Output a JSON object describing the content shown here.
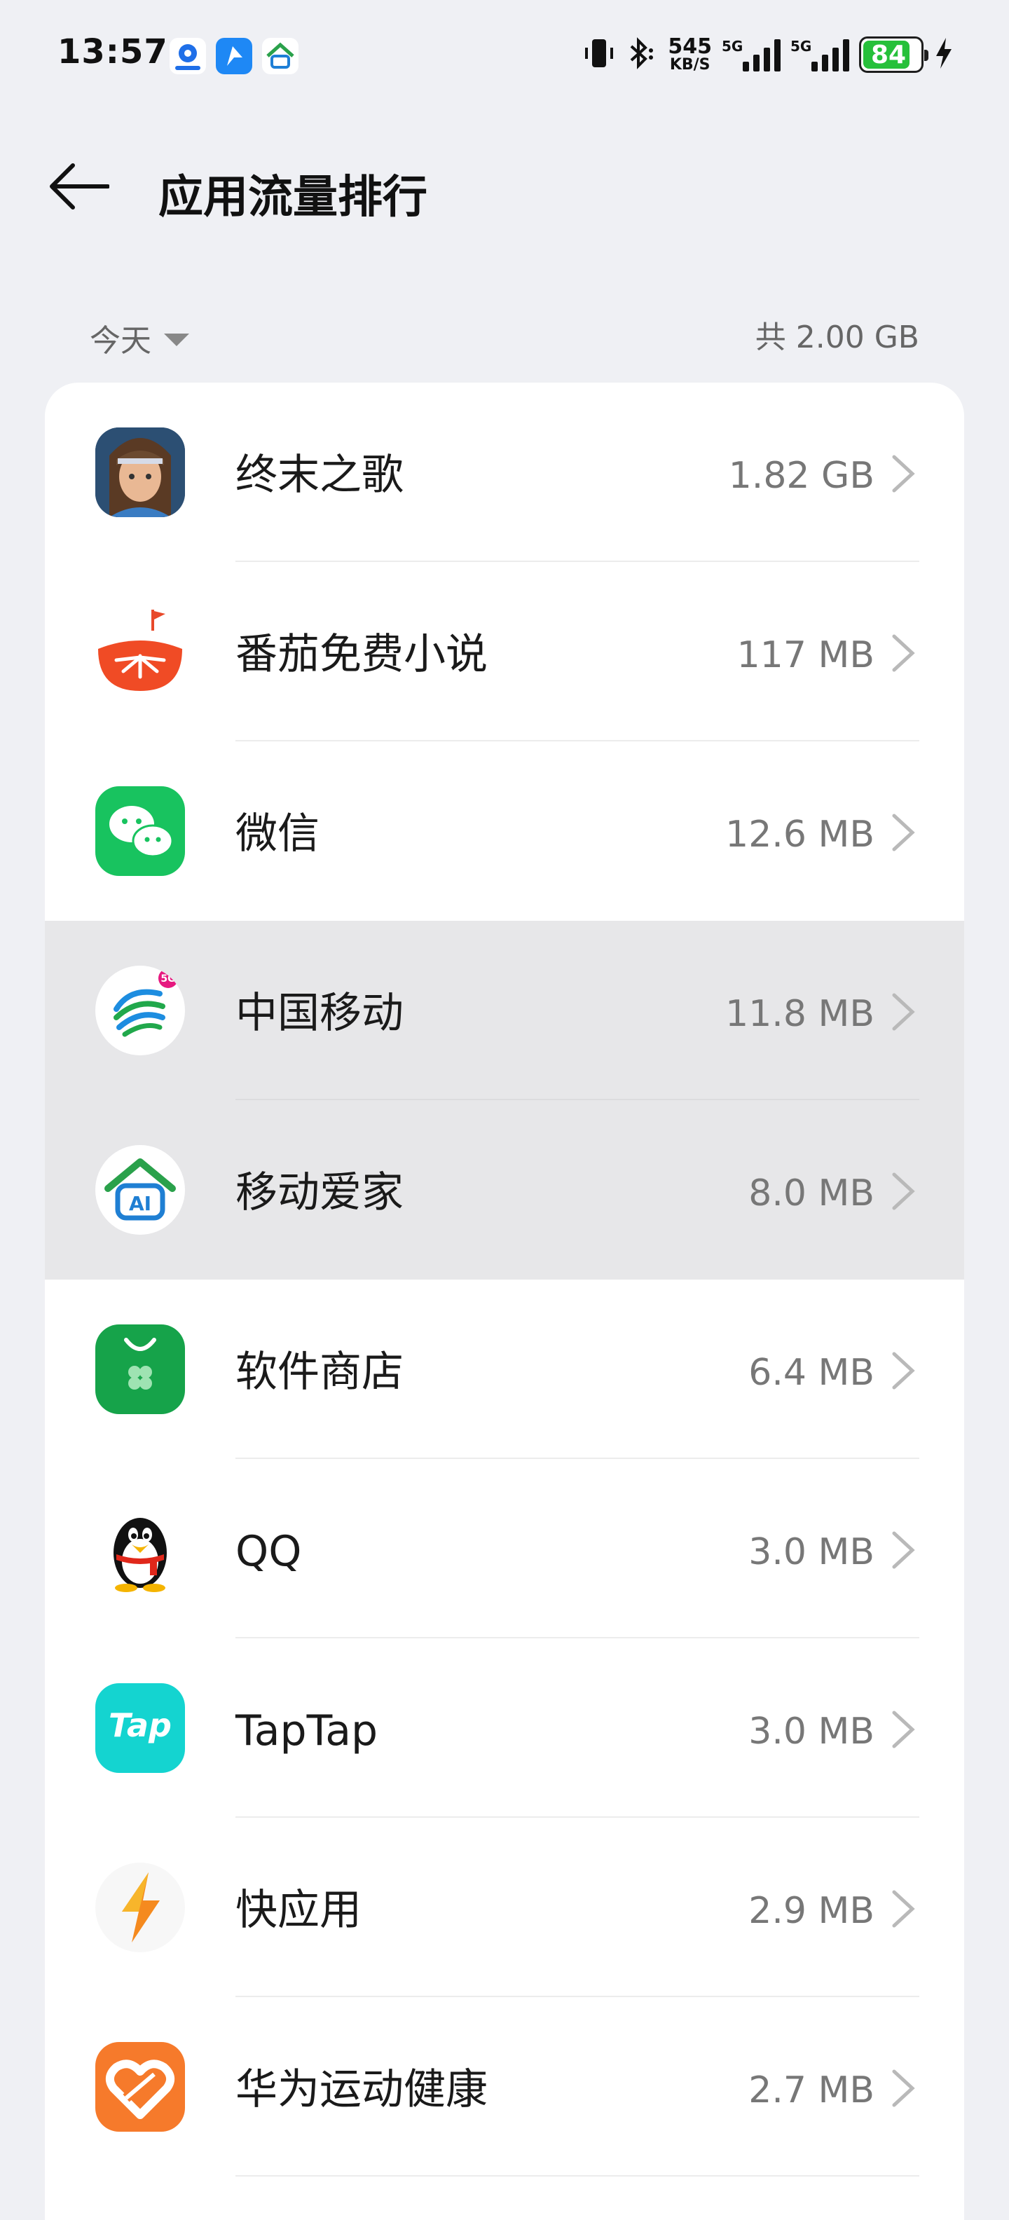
{
  "status_bar": {
    "time": "13:57",
    "net_speed_value": "545",
    "net_speed_unit": "KB/S",
    "signal1_label": "5G",
    "signal2_label": "5G",
    "battery_level": "84",
    "battery_color": "#26c03a"
  },
  "header": {
    "title": "应用流量排行"
  },
  "filter": {
    "period": "今天",
    "total": "共 2.00 GB"
  },
  "apps": [
    {
      "name": "终末之歌",
      "size": "1.82 GB"
    },
    {
      "name": "番茄免费小说",
      "size": "117 MB"
    },
    {
      "name": "微信",
      "size": "12.6 MB"
    },
    {
      "name": "中国移动",
      "size": "11.8 MB"
    },
    {
      "name": "移动爱家",
      "size": "8.0 MB"
    },
    {
      "name": "软件商店",
      "size": "6.4 MB"
    },
    {
      "name": "QQ",
      "size": "3.0 MB"
    },
    {
      "name": "TapTap",
      "size": "3.0 MB"
    },
    {
      "name": "快应用",
      "size": "2.9 MB"
    },
    {
      "name": "华为运动健康",
      "size": "2.7 MB"
    }
  ],
  "icons": {
    "back": "arrow-left-icon",
    "chevron": "chevron-right-icon",
    "period_dropdown": "caret-down-icon"
  }
}
